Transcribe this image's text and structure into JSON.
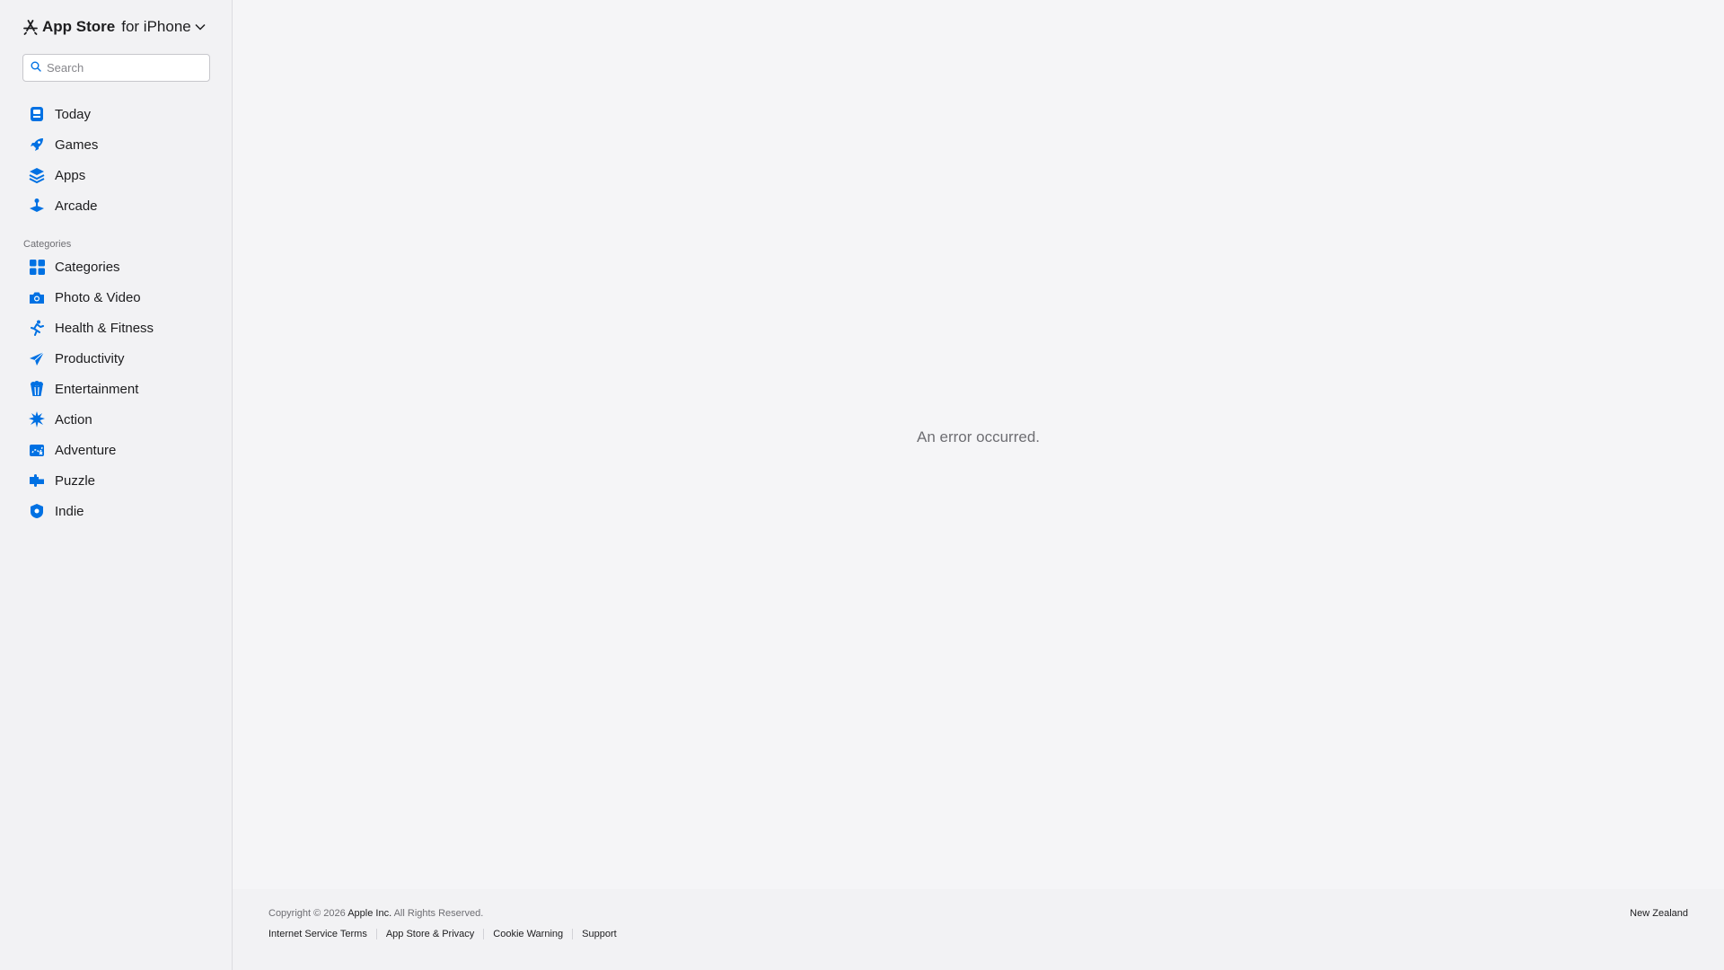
{
  "brand": {
    "store_name": "App Store",
    "platform": "for iPhone"
  },
  "search": {
    "placeholder": "Search"
  },
  "nav": [
    {
      "label": "Today",
      "icon": "today-icon"
    },
    {
      "label": "Games",
      "icon": "rocket-icon"
    },
    {
      "label": "Apps",
      "icon": "layers-icon"
    },
    {
      "label": "Arcade",
      "icon": "joystick-icon"
    }
  ],
  "categories": {
    "heading": "Categories",
    "items": [
      {
        "label": "Categories",
        "icon": "grid-icon"
      },
      {
        "label": "Photo & Video",
        "icon": "camera-icon"
      },
      {
        "label": "Health & Fitness",
        "icon": "runner-icon"
      },
      {
        "label": "Productivity",
        "icon": "paper-plane-icon"
      },
      {
        "label": "Entertainment",
        "icon": "popcorn-icon"
      },
      {
        "label": "Action",
        "icon": "burst-icon"
      },
      {
        "label": "Adventure",
        "icon": "map-icon"
      },
      {
        "label": "Puzzle",
        "icon": "puzzle-icon"
      },
      {
        "label": "Indie",
        "icon": "shield-icon"
      }
    ]
  },
  "main": {
    "error": "An error occurred."
  },
  "footer": {
    "copyright": "Copyright © 2026",
    "company": "Apple Inc.",
    "rights": "All Rights Reserved.",
    "region": "New Zealand",
    "links": [
      "Internet Service Terms",
      "App Store & Privacy",
      "Cookie Warning",
      "Support"
    ]
  },
  "colors": {
    "accent": "#0071e3",
    "text": "#1d1d1f",
    "secondary": "#6e6e73"
  }
}
